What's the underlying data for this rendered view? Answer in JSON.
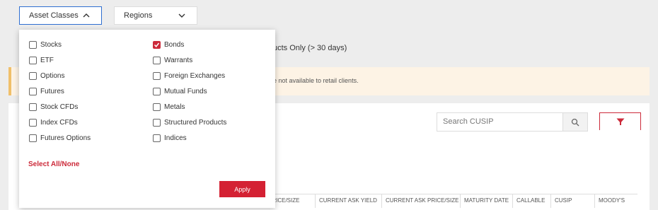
{
  "filters": {
    "asset_classes_label": "Asset Classes",
    "regions_label": "Regions"
  },
  "products_text": "ucts Only (> 30 days)",
  "notice_text": "e not available to retail clients.",
  "search": {
    "placeholder": "Search CUSIP"
  },
  "table_headers": [
    "D PRICE/SIZE",
    "CURRENT ASK YIELD",
    "CURRENT ASK PRICE/SIZE",
    "MATURITY DATE",
    "CALLABLE",
    "CUSIP",
    "MOODY'S"
  ],
  "dropdown": {
    "left_column": [
      {
        "label": "Stocks",
        "checked": false
      },
      {
        "label": "ETF",
        "checked": false
      },
      {
        "label": "Options",
        "checked": false
      },
      {
        "label": "Futures",
        "checked": false
      },
      {
        "label": "Stock CFDs",
        "checked": false
      },
      {
        "label": "Index CFDs",
        "checked": false
      },
      {
        "label": "Futures Options",
        "checked": false
      }
    ],
    "right_column": [
      {
        "label": "Bonds",
        "checked": true
      },
      {
        "label": "Warrants",
        "checked": false
      },
      {
        "label": "Foreign Exchanges",
        "checked": false
      },
      {
        "label": "Mutual Funds",
        "checked": false
      },
      {
        "label": "Metals",
        "checked": false
      },
      {
        "label": "Structured Products",
        "checked": false
      },
      {
        "label": "Indices",
        "checked": false
      }
    ],
    "select_all_label": "Select All/None",
    "apply_label": "Apply"
  },
  "colors": {
    "accent": "#cc2a3a",
    "focus": "#2f6fd1",
    "notice_bg": "#fdf3e5"
  }
}
